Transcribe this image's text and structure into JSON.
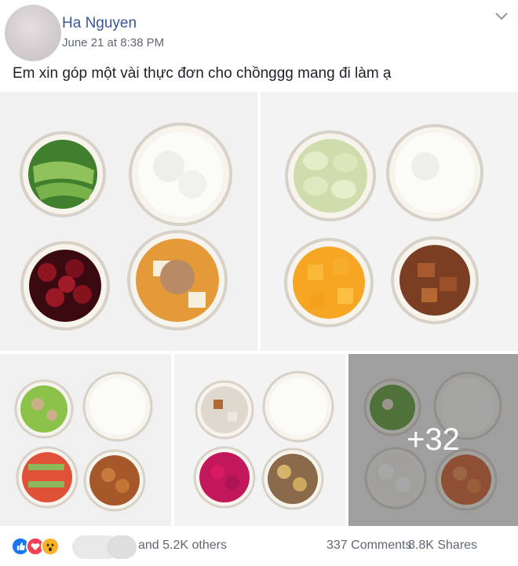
{
  "post": {
    "author": "Ha Nguyen",
    "timestamp": "June 21 at 8:38 PM",
    "text": "Em xin góp một vài thực đơn cho chồnggg mang đi làm ạ"
  },
  "gallery": {
    "more_count": "+32",
    "photos": [
      {
        "dishes": [
          "bok choy",
          "white rice",
          "cherries",
          "tofu with minced meat"
        ]
      },
      {
        "dishes": [
          "cabbage rolls",
          "white rice",
          "mango",
          "braised pork"
        ]
      },
      {
        "dishes": [
          "stir-fried peppers",
          "white rice",
          "watermelon",
          "braised chicken"
        ]
      },
      {
        "dishes": [
          "stir-fried squid",
          "white rice",
          "dragon fruit",
          "braised potatoes"
        ]
      },
      {
        "dishes": [
          "stir-fried greens",
          "white rice",
          "longan",
          "fried shrimp"
        ]
      }
    ]
  },
  "footer": {
    "reactions": [
      "like-icon",
      "love-icon",
      "wow-icon"
    ],
    "reaction_text": "and 5.2K others",
    "comments": "337 Comments",
    "shares": "8.8K Shares"
  },
  "colors": {
    "link": "#385898",
    "muted": "#616770",
    "like": "#1877f2",
    "love": "#f33e58",
    "wow": "#f7b125"
  }
}
